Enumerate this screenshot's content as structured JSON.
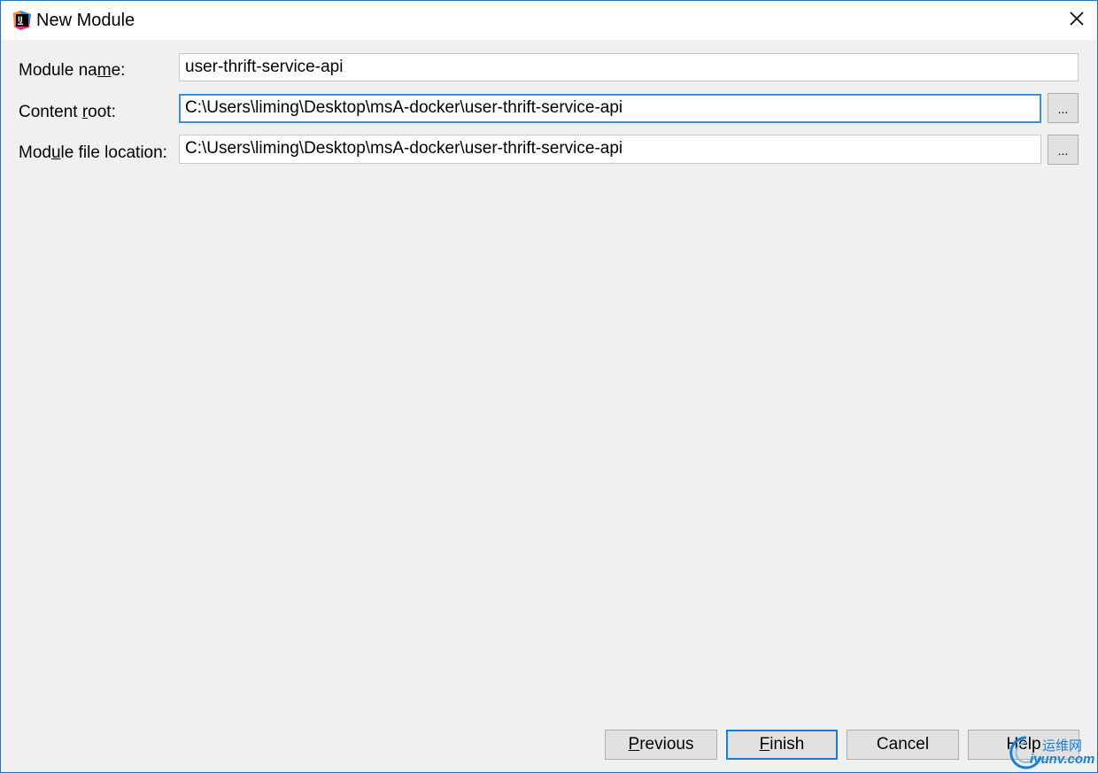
{
  "window": {
    "title": "New Module"
  },
  "form": {
    "module_name": {
      "label_pre": "Module na",
      "label_mnemonic": "m",
      "label_post": "e:",
      "value": "user-thrift-service-api"
    },
    "content_root": {
      "label_pre": "Content ",
      "label_mnemonic": "r",
      "label_post": "oot:",
      "value": "C:\\Users\\liming\\Desktop\\msA-docker\\user-thrift-service-api",
      "browse_label": "..."
    },
    "module_file_location": {
      "label_pre": "Mod",
      "label_mnemonic": "u",
      "label_post": "le file location:",
      "value": "C:\\Users\\liming\\Desktop\\msA-docker\\user-thrift-service-api",
      "browse_label": "..."
    }
  },
  "buttons": {
    "previous": {
      "mnemonic": "P",
      "rest": "revious"
    },
    "finish": {
      "mnemonic": "F",
      "rest": "inish"
    },
    "cancel": {
      "label": "Cancel"
    },
    "help": {
      "label": "Help"
    }
  },
  "watermark": {
    "cn": "运维网",
    "url": "iyunv.com"
  },
  "colors": {
    "accent": "#1e73be",
    "focus": "#3b8fd8",
    "dialog_bg": "#f0f0f0",
    "button_bg": "#e1e1e1"
  },
  "icons": {
    "app": "intellij-idea-icon",
    "close": "close-icon"
  }
}
